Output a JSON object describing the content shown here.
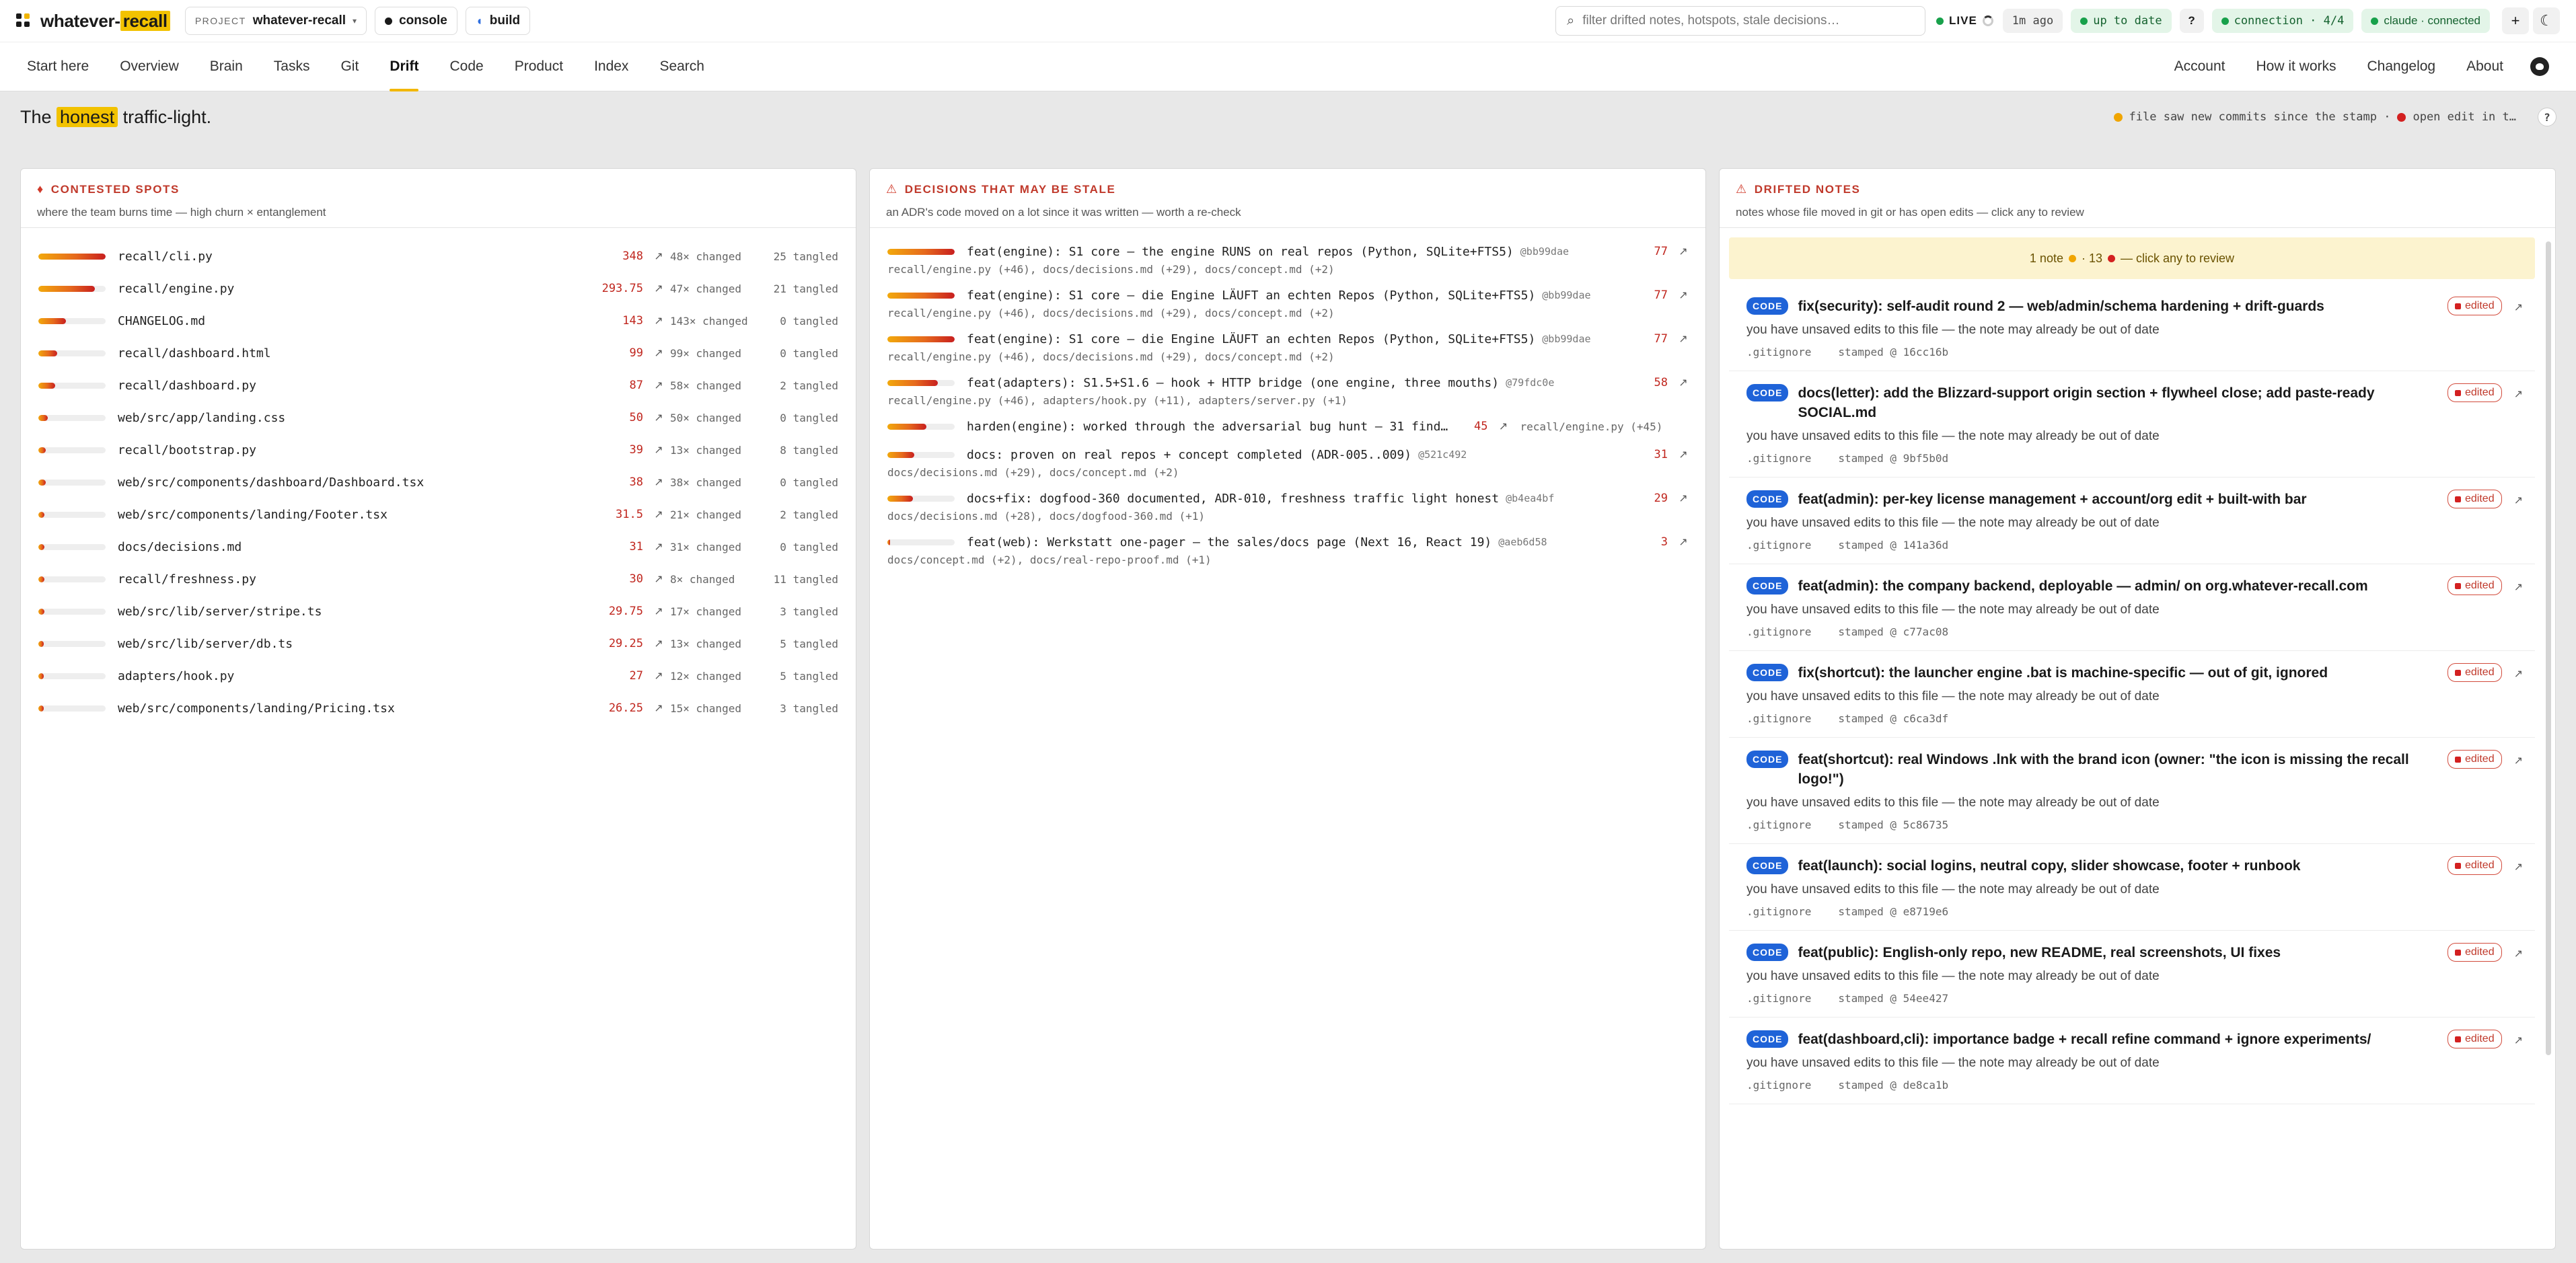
{
  "app": {
    "brand_prefix": "whatever-",
    "brand_highlight": "recall"
  },
  "topbar": {
    "project_label": "PROJECT",
    "project_value": "whatever-recall",
    "console_label": "console",
    "build_label": "build",
    "search_placeholder": "filter drifted notes, hotspots, stale decisions…",
    "live_label": "LIVE",
    "ago": "1m ago",
    "up_to_date": "up to date",
    "help": "?",
    "connection": "connection · 4/4",
    "claude": "claude · connected",
    "plus": "+",
    "theme": "☾"
  },
  "nav": {
    "left": [
      "Start here",
      "Overview",
      "Brain",
      "Tasks",
      "Git",
      "Drift",
      "Code",
      "Product",
      "Index",
      "Search"
    ],
    "active": "Drift",
    "right": [
      "Account",
      "How it works",
      "Changelog",
      "About"
    ]
  },
  "headline": {
    "pre": "The ",
    "highlight": "honest",
    "post": " traffic-light.",
    "legend_yellow": "file saw new commits since the stamp ·",
    "legend_red": "open edit in t…",
    "help": "?"
  },
  "colors": {
    "accent": "#f2c200",
    "red": "#c0392b",
    "badge_blue": "#1f63d8",
    "green": "#18a14b"
  },
  "hotspots": {
    "title": "CONTESTED SPOTS",
    "subtitle": "where the team burns time — high churn × entanglement",
    "rows": [
      {
        "path": "recall/cli.py",
        "score": "348",
        "changed": "48× changed",
        "tangled": "25 tangled",
        "fill": 1.0
      },
      {
        "path": "recall/engine.py",
        "score": "293.75",
        "changed": "47× changed",
        "tangled": "21 tangled",
        "fill": 0.84
      },
      {
        "path": "CHANGELOG.md",
        "score": "143",
        "changed": "143× changed",
        "tangled": "0 tangled",
        "fill": 0.41
      },
      {
        "path": "recall/dashboard.html",
        "score": "99",
        "changed": "99× changed",
        "tangled": "0 tangled",
        "fill": 0.28
      },
      {
        "path": "recall/dashboard.py",
        "score": "87",
        "changed": "58× changed",
        "tangled": "2 tangled",
        "fill": 0.25
      },
      {
        "path": "web/src/app/landing.css",
        "score": "50",
        "changed": "50× changed",
        "tangled": "0 tangled",
        "fill": 0.14
      },
      {
        "path": "recall/bootstrap.py",
        "score": "39",
        "changed": "13× changed",
        "tangled": "8 tangled",
        "fill": 0.11
      },
      {
        "path": "web/src/components/dashboard/Dashboard.tsx",
        "score": "38",
        "changed": "38× changed",
        "tangled": "0 tangled",
        "fill": 0.11
      },
      {
        "path": "web/src/components/landing/Footer.tsx",
        "score": "31.5",
        "changed": "21× changed",
        "tangled": "2 tangled",
        "fill": 0.09
      },
      {
        "path": "docs/decisions.md",
        "score": "31",
        "changed": "31× changed",
        "tangled": "0 tangled",
        "fill": 0.09
      },
      {
        "path": "recall/freshness.py",
        "score": "30",
        "changed": "8× changed",
        "tangled": "11 tangled",
        "fill": 0.09
      },
      {
        "path": "web/src/lib/server/stripe.ts",
        "score": "29.75",
        "changed": "17× changed",
        "tangled": "3 tangled",
        "fill": 0.09
      },
      {
        "path": "web/src/lib/server/db.ts",
        "score": "29.25",
        "changed": "13× changed",
        "tangled": "5 tangled",
        "fill": 0.08
      },
      {
        "path": "adapters/hook.py",
        "score": "27",
        "changed": "12× changed",
        "tangled": "5 tangled",
        "fill": 0.08
      },
      {
        "path": "web/src/components/landing/Pricing.tsx",
        "score": "26.25",
        "changed": "15× changed",
        "tangled": "3 tangled",
        "fill": 0.08
      }
    ]
  },
  "decisions": {
    "title": "DECISIONS THAT MAY BE STALE",
    "subtitle": "an ADR's code moved on a lot since it was written — worth a re-check",
    "rows": [
      {
        "title": "feat(engine): S1 core — the engine RUNS on real repos (Python, SQLite+FTS5)",
        "hash": "@bb99dae",
        "score": "77",
        "files": "recall/engine.py (+46), docs/decisions.md (+29), docs/concept.md (+2)",
        "fill": 1.0
      },
      {
        "title": "feat(engine): S1 core — die Engine LÄUFT an echten Repos (Python, SQLite+FTS5)",
        "hash": "@bb99dae",
        "score": "77",
        "files": "recall/engine.py (+46), docs/decisions.md (+29), docs/concept.md (+2)",
        "fill": 1.0
      },
      {
        "title": "feat(engine): S1 core — die Engine LÄUFT an echten Repos (Python, SQLite+FTS5)",
        "hash": "@bb99dae",
        "score": "77",
        "files": "recall/engine.py (+46), docs/decisions.md (+29), docs/concept.md (+2)",
        "fill": 1.0
      },
      {
        "title": "feat(adapters): S1.5+S1.6 — hook + HTTP bridge (one engine, three mouths)",
        "hash": "@79fdc0e",
        "score": "58",
        "files": "recall/engine.py (+46), adapters/hook.py (+11), adapters/server.py (+1)",
        "fill": 0.75
      },
      {
        "title": "harden(engine): worked through the adversarial bug hunt — 31 findi…",
        "hash": "",
        "score": "45",
        "files": "recall/engine.py (+45)",
        "fill": 0.58,
        "inline": true
      },
      {
        "title": "docs: proven on real repos + concept completed (ADR-005..009)",
        "hash": "@521c492",
        "score": "31",
        "files": "docs/decisions.md (+29), docs/concept.md (+2)",
        "fill": 0.4
      },
      {
        "title": "docs+fix: dogfood-360 documented, ADR-010, freshness traffic light honest",
        "hash": "@b4ea4bf",
        "score": "29",
        "files": "docs/decisions.md (+28), docs/dogfood-360.md (+1)",
        "fill": 0.38
      },
      {
        "title": "feat(web): Werkstatt one-pager — the sales/docs page (Next 16, React 19)",
        "hash": "@aeb6d58",
        "score": "3",
        "files": "docs/concept.md (+2), docs/real-repo-proof.md (+1)",
        "fill": 0.04
      }
    ]
  },
  "drifted": {
    "title": "DRIFTED NOTES",
    "subtitle": "notes whose file moved in git or has open edits — click any to review",
    "banner_pre": "1 note",
    "banner_mid": "· 13",
    "banner_post": "— click any to review",
    "badge": "CODE",
    "edited_label": "edited",
    "notes": [
      {
        "title": "fix(security): self-audit round 2 — web/admin/schema hardening + drift-guards",
        "msg": "you have unsaved edits to this file — the note may already be out of date",
        "file": ".gitignore",
        "stamp": "stamped @ 16cc16b"
      },
      {
        "title": "docs(letter): add the Blizzard-support origin section + flywheel close; add paste-ready SOCIAL.md",
        "msg": "you have unsaved edits to this file — the note may already be out of date",
        "file": ".gitignore",
        "stamp": "stamped @ 9bf5b0d"
      },
      {
        "title": "feat(admin): per-key license management + account/org edit + built-with bar",
        "msg": "you have unsaved edits to this file — the note may already be out of date",
        "file": ".gitignore",
        "stamp": "stamped @ 141a36d"
      },
      {
        "title": "feat(admin): the company backend, deployable — admin/ on org.whatever-recall.com",
        "msg": "you have unsaved edits to this file — the note may already be out of date",
        "file": ".gitignore",
        "stamp": "stamped @ c77ac08"
      },
      {
        "title": "fix(shortcut): the launcher engine .bat is machine-specific — out of git, ignored",
        "msg": "you have unsaved edits to this file — the note may already be out of date",
        "file": ".gitignore",
        "stamp": "stamped @ c6ca3df"
      },
      {
        "title": "feat(shortcut): real Windows .lnk with the brand icon (owner: \"the icon is missing the recall logo!\")",
        "msg": "you have unsaved edits to this file — the note may already be out of date",
        "file": ".gitignore",
        "stamp": "stamped @ 5c86735"
      },
      {
        "title": "feat(launch): social logins, neutral copy, slider showcase, footer + runbook",
        "msg": "you have unsaved edits to this file — the note may already be out of date",
        "file": ".gitignore",
        "stamp": "stamped @ e8719e6"
      },
      {
        "title": "feat(public): English-only repo, new README, real screenshots, UI fixes",
        "msg": "you have unsaved edits to this file — the note may already be out of date",
        "file": ".gitignore",
        "stamp": "stamped @ 54ee427"
      },
      {
        "title": "feat(dashboard,cli): importance badge + recall refine command + ignore experiments/",
        "msg": "you have unsaved edits to this file — the note may already be out of date",
        "file": ".gitignore",
        "stamp": "stamped @ de8ca1b"
      }
    ]
  }
}
